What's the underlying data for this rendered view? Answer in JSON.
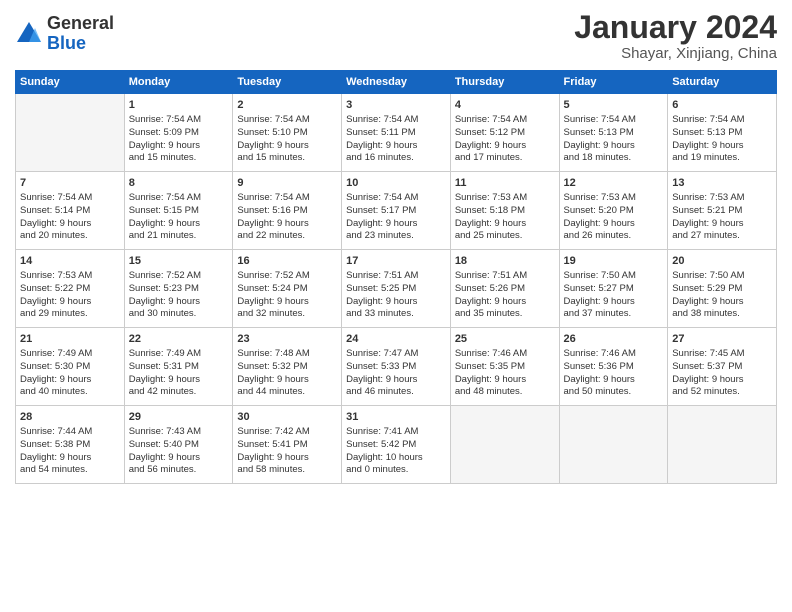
{
  "logo": {
    "general": "General",
    "blue": "Blue"
  },
  "header": {
    "month": "January 2024",
    "location": "Shayar, Xinjiang, China"
  },
  "days_of_week": [
    "Sunday",
    "Monday",
    "Tuesday",
    "Wednesday",
    "Thursday",
    "Friday",
    "Saturday"
  ],
  "weeks": [
    [
      {
        "day": "",
        "content": ""
      },
      {
        "day": "1",
        "content": "Sunrise: 7:54 AM\nSunset: 5:09 PM\nDaylight: 9 hours\nand 15 minutes."
      },
      {
        "day": "2",
        "content": "Sunrise: 7:54 AM\nSunset: 5:10 PM\nDaylight: 9 hours\nand 15 minutes."
      },
      {
        "day": "3",
        "content": "Sunrise: 7:54 AM\nSunset: 5:11 PM\nDaylight: 9 hours\nand 16 minutes."
      },
      {
        "day": "4",
        "content": "Sunrise: 7:54 AM\nSunset: 5:12 PM\nDaylight: 9 hours\nand 17 minutes."
      },
      {
        "day": "5",
        "content": "Sunrise: 7:54 AM\nSunset: 5:13 PM\nDaylight: 9 hours\nand 18 minutes."
      },
      {
        "day": "6",
        "content": "Sunrise: 7:54 AM\nSunset: 5:13 PM\nDaylight: 9 hours\nand 19 minutes."
      }
    ],
    [
      {
        "day": "7",
        "content": "Sunrise: 7:54 AM\nSunset: 5:14 PM\nDaylight: 9 hours\nand 20 minutes."
      },
      {
        "day": "8",
        "content": "Sunrise: 7:54 AM\nSunset: 5:15 PM\nDaylight: 9 hours\nand 21 minutes."
      },
      {
        "day": "9",
        "content": "Sunrise: 7:54 AM\nSunset: 5:16 PM\nDaylight: 9 hours\nand 22 minutes."
      },
      {
        "day": "10",
        "content": "Sunrise: 7:54 AM\nSunset: 5:17 PM\nDaylight: 9 hours\nand 23 minutes."
      },
      {
        "day": "11",
        "content": "Sunrise: 7:53 AM\nSunset: 5:18 PM\nDaylight: 9 hours\nand 25 minutes."
      },
      {
        "day": "12",
        "content": "Sunrise: 7:53 AM\nSunset: 5:20 PM\nDaylight: 9 hours\nand 26 minutes."
      },
      {
        "day": "13",
        "content": "Sunrise: 7:53 AM\nSunset: 5:21 PM\nDaylight: 9 hours\nand 27 minutes."
      }
    ],
    [
      {
        "day": "14",
        "content": "Sunrise: 7:53 AM\nSunset: 5:22 PM\nDaylight: 9 hours\nand 29 minutes."
      },
      {
        "day": "15",
        "content": "Sunrise: 7:52 AM\nSunset: 5:23 PM\nDaylight: 9 hours\nand 30 minutes."
      },
      {
        "day": "16",
        "content": "Sunrise: 7:52 AM\nSunset: 5:24 PM\nDaylight: 9 hours\nand 32 minutes."
      },
      {
        "day": "17",
        "content": "Sunrise: 7:51 AM\nSunset: 5:25 PM\nDaylight: 9 hours\nand 33 minutes."
      },
      {
        "day": "18",
        "content": "Sunrise: 7:51 AM\nSunset: 5:26 PM\nDaylight: 9 hours\nand 35 minutes."
      },
      {
        "day": "19",
        "content": "Sunrise: 7:50 AM\nSunset: 5:27 PM\nDaylight: 9 hours\nand 37 minutes."
      },
      {
        "day": "20",
        "content": "Sunrise: 7:50 AM\nSunset: 5:29 PM\nDaylight: 9 hours\nand 38 minutes."
      }
    ],
    [
      {
        "day": "21",
        "content": "Sunrise: 7:49 AM\nSunset: 5:30 PM\nDaylight: 9 hours\nand 40 minutes."
      },
      {
        "day": "22",
        "content": "Sunrise: 7:49 AM\nSunset: 5:31 PM\nDaylight: 9 hours\nand 42 minutes."
      },
      {
        "day": "23",
        "content": "Sunrise: 7:48 AM\nSunset: 5:32 PM\nDaylight: 9 hours\nand 44 minutes."
      },
      {
        "day": "24",
        "content": "Sunrise: 7:47 AM\nSunset: 5:33 PM\nDaylight: 9 hours\nand 46 minutes."
      },
      {
        "day": "25",
        "content": "Sunrise: 7:46 AM\nSunset: 5:35 PM\nDaylight: 9 hours\nand 48 minutes."
      },
      {
        "day": "26",
        "content": "Sunrise: 7:46 AM\nSunset: 5:36 PM\nDaylight: 9 hours\nand 50 minutes."
      },
      {
        "day": "27",
        "content": "Sunrise: 7:45 AM\nSunset: 5:37 PM\nDaylight: 9 hours\nand 52 minutes."
      }
    ],
    [
      {
        "day": "28",
        "content": "Sunrise: 7:44 AM\nSunset: 5:38 PM\nDaylight: 9 hours\nand 54 minutes."
      },
      {
        "day": "29",
        "content": "Sunrise: 7:43 AM\nSunset: 5:40 PM\nDaylight: 9 hours\nand 56 minutes."
      },
      {
        "day": "30",
        "content": "Sunrise: 7:42 AM\nSunset: 5:41 PM\nDaylight: 9 hours\nand 58 minutes."
      },
      {
        "day": "31",
        "content": "Sunrise: 7:41 AM\nSunset: 5:42 PM\nDaylight: 10 hours\nand 0 minutes."
      },
      {
        "day": "",
        "content": ""
      },
      {
        "day": "",
        "content": ""
      },
      {
        "day": "",
        "content": ""
      }
    ]
  ]
}
